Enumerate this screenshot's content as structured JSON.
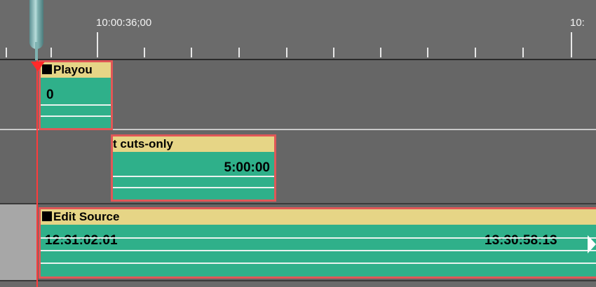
{
  "ruler": {
    "timecode_left": "10:00:36;00",
    "timecode_right": "10:"
  },
  "clips": {
    "playout": {
      "name": "Playou",
      "value": "0"
    },
    "cuts_only": {
      "name": "t cuts-only",
      "end_tc": "5:00:00"
    },
    "edit_source": {
      "name": "Edit Source",
      "start_tc": "12:31:02:01",
      "end_tc": "13:30:58:13"
    }
  },
  "colors": {
    "clip_body": "#2fb08a",
    "clip_title": "#e6d586",
    "clip_border": "#e05757",
    "playhead": "#ff3b3b"
  }
}
